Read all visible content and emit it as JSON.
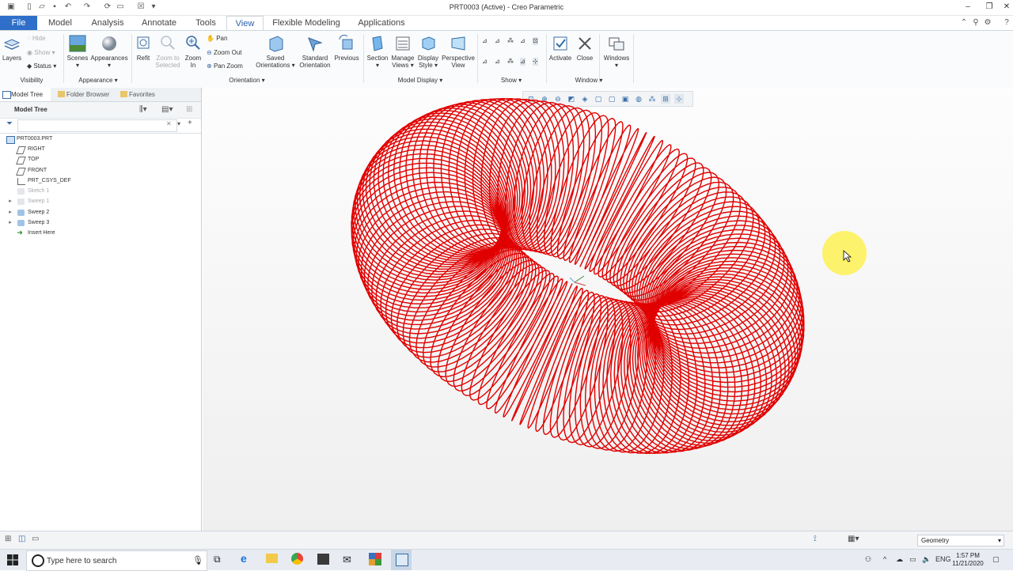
{
  "window": {
    "title": "PRT0003 (Active) - Creo Parametric"
  },
  "tabs": [
    {
      "label": "File"
    },
    {
      "label": "Model"
    },
    {
      "label": "Analysis"
    },
    {
      "label": "Annotate"
    },
    {
      "label": "Tools"
    },
    {
      "label": "View"
    },
    {
      "label": "Flexible Modeling"
    },
    {
      "label": "Applications"
    }
  ],
  "ribbon": {
    "visibility": {
      "layers": "Layers",
      "hide": "Hide",
      "show": "Show",
      "status": "Status",
      "label": "Visibility"
    },
    "appearance": {
      "scenes": "Scenes",
      "appearances": "Appearances",
      "label": "Appearance"
    },
    "orientation": {
      "refit": "Refit",
      "zoom_selected_1": "Zoom to",
      "zoom_selected_2": "Selected",
      "zoom_in_1": "Zoom",
      "zoom_in_2": "In",
      "pan": "Pan",
      "zoom_out": "Zoom Out",
      "pan_zoom": "Pan Zoom",
      "saved_1": "Saved",
      "saved_2": "Orientations",
      "standard_1": "Standard",
      "standard_2": "Orientation",
      "previous": "Previous",
      "label": "Orientation"
    },
    "model_display": {
      "section": "Section",
      "manage_1": "Manage",
      "manage_2": "Views",
      "display_1": "Display",
      "display_2": "Style",
      "perspective_1": "Perspective",
      "perspective_2": "View",
      "label": "Model Display"
    },
    "show": {
      "label": "Show"
    },
    "window": {
      "activate": "Activate",
      "close": "Close",
      "windows": "Windows",
      "label": "Window"
    }
  },
  "navigator": {
    "tabs": [
      {
        "label": "Model Tree"
      },
      {
        "label": "Folder Browser"
      },
      {
        "label": "Favorites"
      }
    ],
    "header": "Model Tree",
    "filter_placeholder": "",
    "items": [
      {
        "label": "PRT0003.PRT",
        "dim": false
      },
      {
        "label": "RIGHT",
        "dim": false
      },
      {
        "label": "TOP",
        "dim": false
      },
      {
        "label": "FRONT",
        "dim": false
      },
      {
        "label": "PRT_CSYS_DEF",
        "dim": false
      },
      {
        "label": "Sketch 1",
        "dim": true
      },
      {
        "label": "Sweep 1",
        "dim": true
      },
      {
        "label": "Sweep 2",
        "dim": false
      },
      {
        "label": "Sweep 3",
        "dim": false
      },
      {
        "label": "Insert Here",
        "dim": false
      }
    ]
  },
  "viewport": {
    "model_color": "#e00000"
  },
  "statusbar": {
    "selection_filter": "Geometry"
  },
  "taskbar": {
    "search_placeholder": "Type here to search",
    "lang": "ENG",
    "time": "1:57 PM",
    "date": "11/21/2020"
  }
}
